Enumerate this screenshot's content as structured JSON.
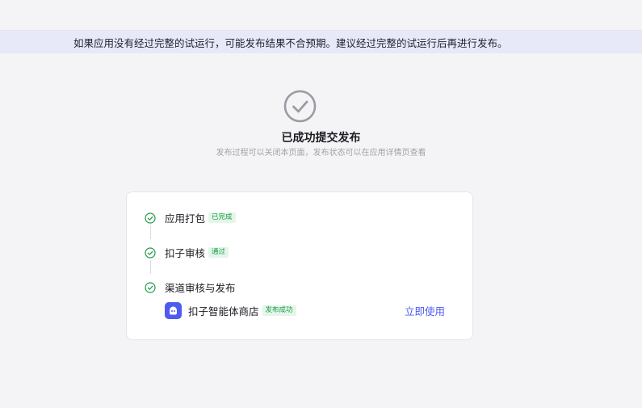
{
  "notice": {
    "text": "如果应用没有经过完整的试运行，可能发布结果不合预期。建议经过完整的试运行后再进行发布。"
  },
  "result": {
    "title": "已成功提交发布",
    "subtitle": "发布过程可以关闭本页面，发布状态可以在应用详情页查看",
    "icon": "check-circle-icon"
  },
  "steps": [
    {
      "label": "应用打包",
      "tag": "已完成",
      "icon": "check-circle-icon"
    },
    {
      "label": "扣子审核",
      "tag": "通过",
      "icon": "check-circle-icon"
    },
    {
      "label": "渠道审核与发布",
      "icon": "check-circle-icon"
    }
  ],
  "channel": {
    "name": "扣子智能体商店",
    "tag": "发布成功",
    "action": "立即使用",
    "icon": "coze-store-logo-icon"
  },
  "colors": {
    "accent": "#4d5bf0",
    "success": "#1c9a47",
    "success_bg": "#e4f6ea",
    "notice_bg": "#e7e8f8"
  }
}
